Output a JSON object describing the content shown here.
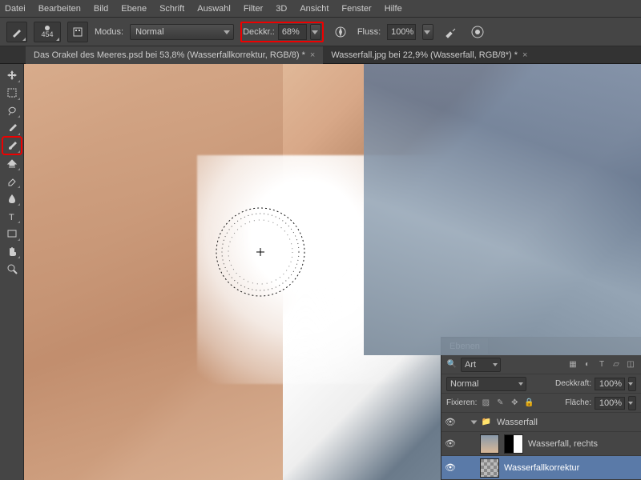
{
  "menu": {
    "items": [
      "Datei",
      "Bearbeiten",
      "Bild",
      "Ebene",
      "Schrift",
      "Auswahl",
      "Filter",
      "3D",
      "Ansicht",
      "Fenster",
      "Hilfe"
    ]
  },
  "options": {
    "brush_size": "454",
    "mode_label": "Modus:",
    "mode_value": "Normal",
    "opacity_label": "Deckkr.:",
    "opacity_value": "68%",
    "flow_label": "Fluss:",
    "flow_value": "100%"
  },
  "tabs": [
    {
      "label": "Das Orakel des Meeres.psd bei 53,8% (Wasserfallkorrektur, RGB/8) *"
    },
    {
      "label": "Wasserfall.jpg bei 22,9% (Wasserfall, RGB/8*) *"
    }
  ],
  "layers_panel": {
    "title": "Ebenen",
    "filter_label": "Art",
    "blend": "Normal",
    "opacity_label": "Deckkraft:",
    "opacity": "100%",
    "lock_label": "Fixieren:",
    "fill_label": "Fläche:",
    "fill": "100%",
    "group": "Wasserfall",
    "layers": [
      {
        "name": "Wasserfall, rechts"
      },
      {
        "name": "Wasserfallkorrektur"
      }
    ]
  }
}
